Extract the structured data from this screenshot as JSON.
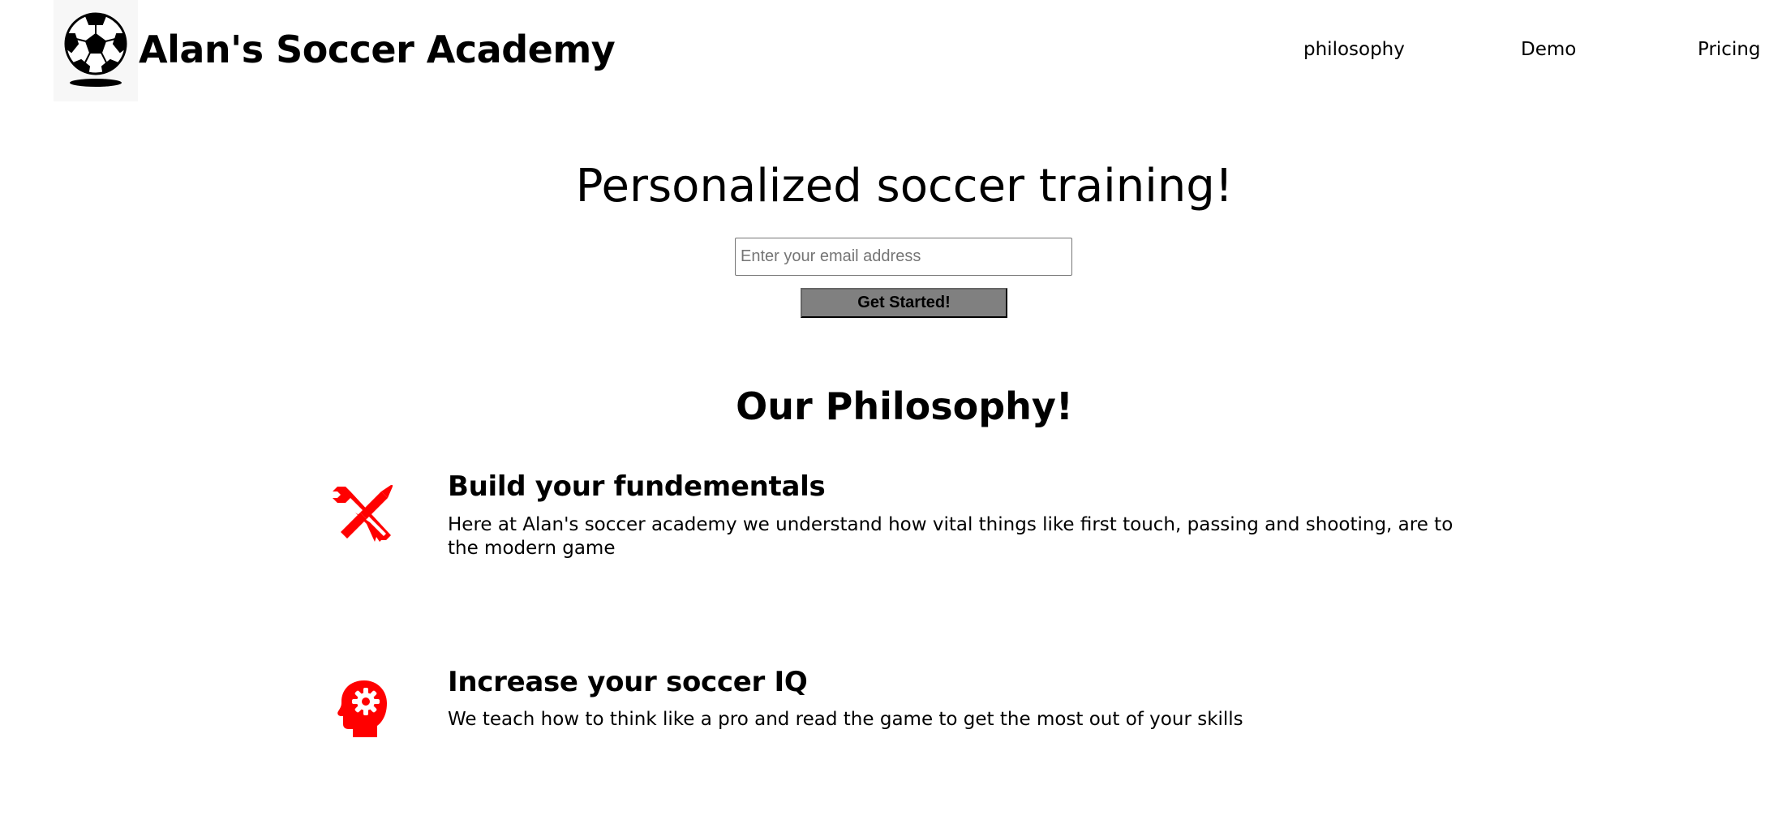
{
  "header": {
    "logo_icon": "soccer-ball-icon",
    "title": "Alan's Soccer Academy",
    "nav": [
      {
        "label": "philosophy"
      },
      {
        "label": "Demo"
      },
      {
        "label": "Pricing"
      }
    ]
  },
  "hero": {
    "title": "Personalized soccer training!",
    "email_placeholder": "Enter your email address",
    "email_value": "",
    "cta_label": "Get Started!"
  },
  "philosophy": {
    "title": "Our Philosophy!",
    "accent_color": "#ff0000",
    "features": [
      {
        "icon": "tools-icon",
        "heading": "Build your fundementals",
        "text": "Here at Alan's soccer academy we understand how vital things like first touch, passing and shooting, are to the modern game"
      },
      {
        "icon": "head-gear-icon",
        "heading": "Increase your soccer IQ",
        "text": "We teach how to think like a pro and read the game to get the most out of your skills"
      }
    ]
  }
}
